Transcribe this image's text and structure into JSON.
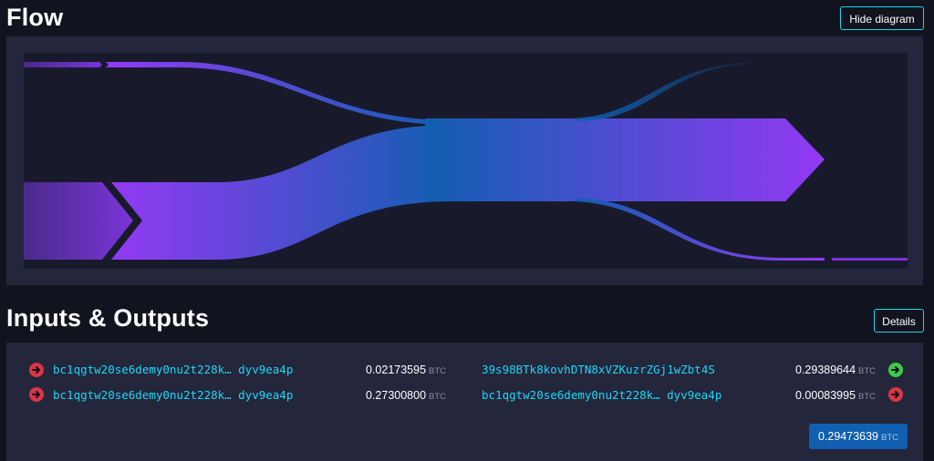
{
  "flow": {
    "title": "Flow",
    "hide_button": "Hide diagram"
  },
  "io": {
    "title": "Inputs & Outputs",
    "details_button": "Details",
    "unit": "BTC",
    "inputs": [
      {
        "address_start": "bc1qgtw20se6demy0nu2t228k…",
        "address_end": "dyv9ea4p",
        "amount": "0.02173595"
      },
      {
        "address_start": "bc1qgtw20se6demy0nu2t228k…",
        "address_end": "dyv9ea4p",
        "amount": "0.27300800"
      }
    ],
    "outputs": [
      {
        "address_start": "39s98BTk8kovhDTN8xVZKuzrZGj1wZbt4S",
        "address_end": "",
        "amount": "0.29389644"
      },
      {
        "address_start": "bc1qgtw20se6demy0nu2t228k…",
        "address_end": "dyv9ea4p",
        "amount": "0.00083995"
      }
    ],
    "total": "0.29473639"
  },
  "colors": {
    "accent": "#1bd8f4",
    "purple": "#9339f4",
    "blue": "#105fb0",
    "red": "#dc3545",
    "green": "#3bcc49"
  }
}
